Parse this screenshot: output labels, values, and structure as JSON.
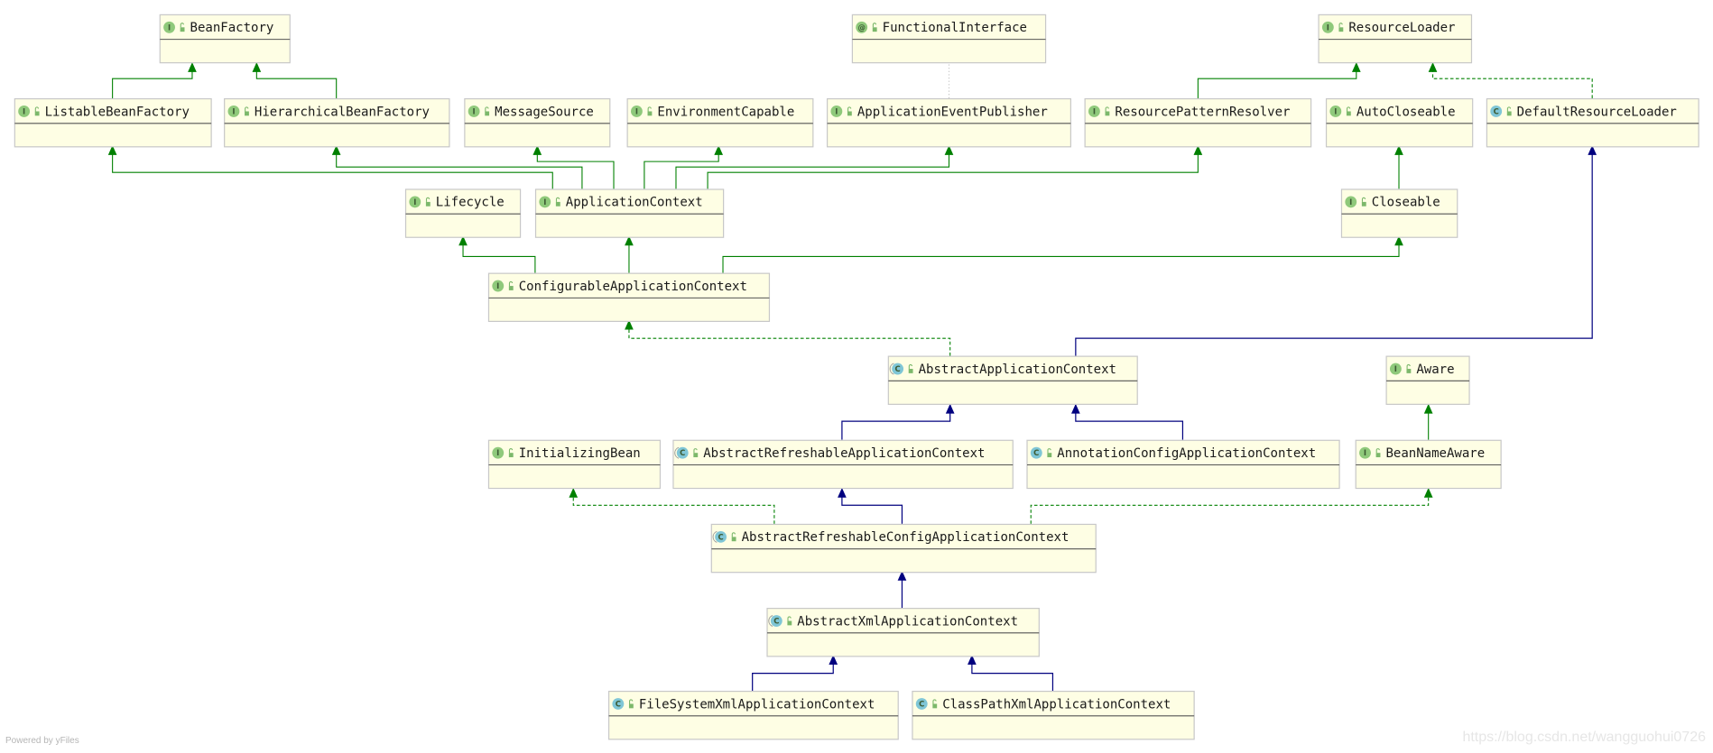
{
  "colors": {
    "node_fill": "#fefee4",
    "node_border": "#c8c8c8",
    "interface_extends": "#008000",
    "implements": "#008000",
    "class_extends": "#00007f",
    "annotation_link": "#c0c0c0",
    "interface_icon": "#8fc97b",
    "class_icon": "#7fc6d6",
    "annotation_icon": "#8fc97b"
  },
  "nodes": [
    {
      "name": "BeanFactory",
      "kind": "interface",
      "icon": "I"
    },
    {
      "name": "FunctionalInterface",
      "kind": "annotation",
      "icon": "@"
    },
    {
      "name": "ResourceLoader",
      "kind": "interface",
      "icon": "I"
    },
    {
      "name": "ListableBeanFactory",
      "kind": "interface",
      "icon": "I"
    },
    {
      "name": "HierarchicalBeanFactory",
      "kind": "interface",
      "icon": "I"
    },
    {
      "name": "MessageSource",
      "kind": "interface",
      "icon": "I"
    },
    {
      "name": "EnvironmentCapable",
      "kind": "interface",
      "icon": "I"
    },
    {
      "name": "ApplicationEventPublisher",
      "kind": "interface",
      "icon": "I"
    },
    {
      "name": "ResourcePatternResolver",
      "kind": "interface",
      "icon": "I"
    },
    {
      "name": "AutoCloseable",
      "kind": "interface",
      "icon": "I"
    },
    {
      "name": "DefaultResourceLoader",
      "kind": "class",
      "icon": "C"
    },
    {
      "name": "Lifecycle",
      "kind": "interface",
      "icon": "I"
    },
    {
      "name": "ApplicationContext",
      "kind": "interface",
      "icon": "I"
    },
    {
      "name": "Closeable",
      "kind": "interface",
      "icon": "I"
    },
    {
      "name": "ConfigurableApplicationContext",
      "kind": "interface",
      "icon": "I"
    },
    {
      "name": "AbstractApplicationContext",
      "kind": "abstract-class",
      "icon": "C"
    },
    {
      "name": "Aware",
      "kind": "interface",
      "icon": "I"
    },
    {
      "name": "InitializingBean",
      "kind": "interface",
      "icon": "I"
    },
    {
      "name": "AbstractRefreshableApplicationContext",
      "kind": "abstract-class",
      "icon": "C"
    },
    {
      "name": "AnnotationConfigApplicationContext",
      "kind": "class",
      "icon": "C"
    },
    {
      "name": "BeanNameAware",
      "kind": "interface",
      "icon": "I"
    },
    {
      "name": "AbstractRefreshableConfigApplicationContext",
      "kind": "abstract-class",
      "icon": "C"
    },
    {
      "name": "AbstractXmlApplicationContext",
      "kind": "abstract-class",
      "icon": "C"
    },
    {
      "name": "FileSystemXmlApplicationContext",
      "kind": "class",
      "icon": "C"
    },
    {
      "name": "ClassPathXmlApplicationContext",
      "kind": "class",
      "icon": "C"
    }
  ],
  "edges": [
    {
      "from": "ListableBeanFactory",
      "to": "BeanFactory",
      "type": "interface_extends"
    },
    {
      "from": "HierarchicalBeanFactory",
      "to": "BeanFactory",
      "type": "interface_extends"
    },
    {
      "from": "ApplicationEventPublisher",
      "to": "FunctionalInterface",
      "type": "annotation_link"
    },
    {
      "from": "ResourcePatternResolver",
      "to": "ResourceLoader",
      "type": "interface_extends"
    },
    {
      "from": "DefaultResourceLoader",
      "to": "ResourceLoader",
      "type": "implements"
    },
    {
      "from": "ApplicationContext",
      "to": "ListableBeanFactory",
      "type": "interface_extends"
    },
    {
      "from": "ApplicationContext",
      "to": "HierarchicalBeanFactory",
      "type": "interface_extends"
    },
    {
      "from": "ApplicationContext",
      "to": "MessageSource",
      "type": "interface_extends"
    },
    {
      "from": "ApplicationContext",
      "to": "EnvironmentCapable",
      "type": "interface_extends"
    },
    {
      "from": "ApplicationContext",
      "to": "ApplicationEventPublisher",
      "type": "interface_extends"
    },
    {
      "from": "ApplicationContext",
      "to": "ResourcePatternResolver",
      "type": "interface_extends"
    },
    {
      "from": "Closeable",
      "to": "AutoCloseable",
      "type": "interface_extends"
    },
    {
      "from": "ConfigurableApplicationContext",
      "to": "Lifecycle",
      "type": "interface_extends"
    },
    {
      "from": "ConfigurableApplicationContext",
      "to": "ApplicationContext",
      "type": "interface_extends"
    },
    {
      "from": "ConfigurableApplicationContext",
      "to": "Closeable",
      "type": "interface_extends"
    },
    {
      "from": "AbstractApplicationContext",
      "to": "ConfigurableApplicationContext",
      "type": "implements"
    },
    {
      "from": "AbstractApplicationContext",
      "to": "DefaultResourceLoader",
      "type": "class_extends"
    },
    {
      "from": "AbstractRefreshableApplicationContext",
      "to": "AbstractApplicationContext",
      "type": "class_extends"
    },
    {
      "from": "AnnotationConfigApplicationContext",
      "to": "AbstractApplicationContext",
      "type": "class_extends"
    },
    {
      "from": "BeanNameAware",
      "to": "Aware",
      "type": "interface_extends"
    },
    {
      "from": "AbstractRefreshableConfigApplicationContext",
      "to": "InitializingBean",
      "type": "implements"
    },
    {
      "from": "AbstractRefreshableConfigApplicationContext",
      "to": "AbstractRefreshableApplicationContext",
      "type": "class_extends"
    },
    {
      "from": "AbstractRefreshableConfigApplicationContext",
      "to": "BeanNameAware",
      "type": "implements"
    },
    {
      "from": "AbstractXmlApplicationContext",
      "to": "AbstractRefreshableConfigApplicationContext",
      "type": "class_extends"
    },
    {
      "from": "FileSystemXmlApplicationContext",
      "to": "AbstractXmlApplicationContext",
      "type": "class_extends"
    },
    {
      "from": "ClassPathXmlApplicationContext",
      "to": "AbstractXmlApplicationContext",
      "type": "class_extends"
    }
  ],
  "footer": {
    "powered_by": "Powered by yFiles"
  },
  "watermark": {
    "text": "https://blog.csdn.net/wangguohui0726"
  }
}
